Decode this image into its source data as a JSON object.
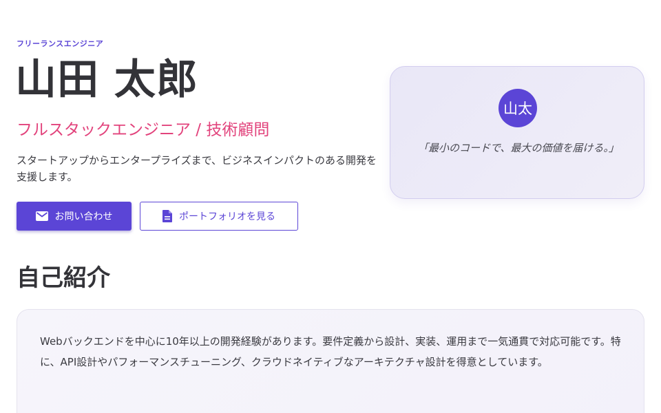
{
  "hero": {
    "eyebrow": "フリーランスエンジニア",
    "name": "山田 太郎",
    "role": "フルスタックエンジニア / 技術顧問",
    "intro": "スタートアップからエンタープライズまで、ビジネスインパクトのある開発を支援します。"
  },
  "buttons": {
    "contact_label": "お問い合わせ",
    "contact_icon": "mail-icon",
    "portfolio_label": "ポートフォリオを見る",
    "portfolio_icon": "document-icon"
  },
  "quote_card": {
    "avatar_text": "山太",
    "quote": "「最小のコードで、最大の価値を届ける。」"
  },
  "about": {
    "title": "自己紹介",
    "body": "Webバックエンドを中心に10年以上の開発経験があります。要件定義から設計、実装、運用まで一気通貫で対応可能です。特に、API設計やパフォーマンスチューニング、クラウドネイティブなアーキテクチャ設計を得意としています。"
  },
  "colors": {
    "accent": "#5b45d6",
    "role_pink": "#e2437c",
    "text_dark": "#333338"
  }
}
